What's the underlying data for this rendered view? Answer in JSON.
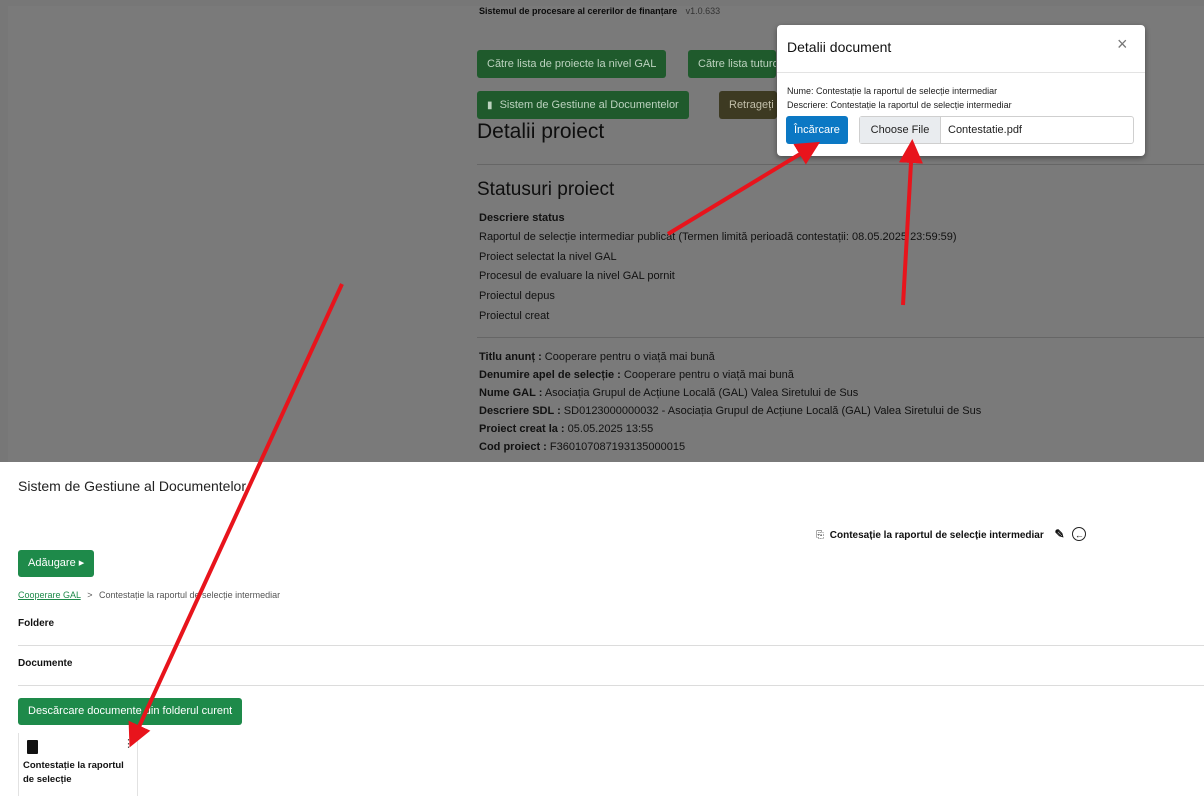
{
  "app": {
    "system_title": "Sistemul de procesare al cererilor de finanțare",
    "version": "v1.0.633"
  },
  "project_page": {
    "buttons": {
      "gal_list": "Către lista de proiecte la nivel GAL",
      "all_list": "Către lista tuturor",
      "doc_mgmt": "Sistem de Gestiune al Documentelor",
      "retract": "Retrageți"
    },
    "details_heading": "Detalii proiect",
    "statuses_heading": "Statusuri proiect",
    "status_col_header": "Descriere status",
    "statuses": [
      "Raportul de selecție intermediar publicat (Termen limită perioadă contestații: 08.05.2025 23:59:59)",
      "Proiect selectat la nivel GAL",
      "Procesul de evaluare la nivel GAL pornit",
      "Proiectul depus",
      "Proiectul creat"
    ],
    "fields": [
      {
        "label": "Titlu anunț :",
        "value": "Cooperare pentru o viață mai bună"
      },
      {
        "label": "Denumire apel de selecție :",
        "value": "Cooperare pentru o viață mai bună"
      },
      {
        "label": "Nume GAL :",
        "value": "Asociația Grupul de Acțiune Locală (GAL) Valea Siretului de Sus"
      },
      {
        "label": "Descriere SDL :",
        "value": "SD0123000000032 - Asociația Grupul de Acțiune Locală (GAL) Valea Siretului de Sus"
      },
      {
        "label": "Proiect creat la :",
        "value": "05.05.2025 13:55"
      },
      {
        "label": "Cod proiect :",
        "value": "F360107087193135000015"
      }
    ]
  },
  "modal": {
    "title": "Detalii document",
    "close_glyph": "×",
    "name_line": "Nume: Contestație la raportul de selecție intermediar",
    "desc_line": "Descriere: Contestație la raportul de selecție intermediar",
    "upload_label": "Încărcare",
    "choose_file_label": "Choose File",
    "file_name": "Contestatie.pdf"
  },
  "sgd": {
    "title": "Sistem de Gestiune al Documentelor",
    "current_doc": "Contesație la raportul de selecție intermediar",
    "add_button": "Adăugare ▸",
    "breadcrumb": {
      "root": "Cooperare GAL",
      "separator": ">",
      "current": "Contestație la raportul de selecție intermediar"
    },
    "folders_label": "Foldere",
    "documents_label": "Documente",
    "download_button": "Descărcare documente din folderul curent",
    "card": {
      "name": "Contestație la raportul de selecție",
      "menu_glyph": "⋮"
    }
  },
  "colors": {
    "green": "#1e8a4a",
    "blue": "#0b78c4",
    "arrow": "#e8141c",
    "overlay": "#777777"
  }
}
